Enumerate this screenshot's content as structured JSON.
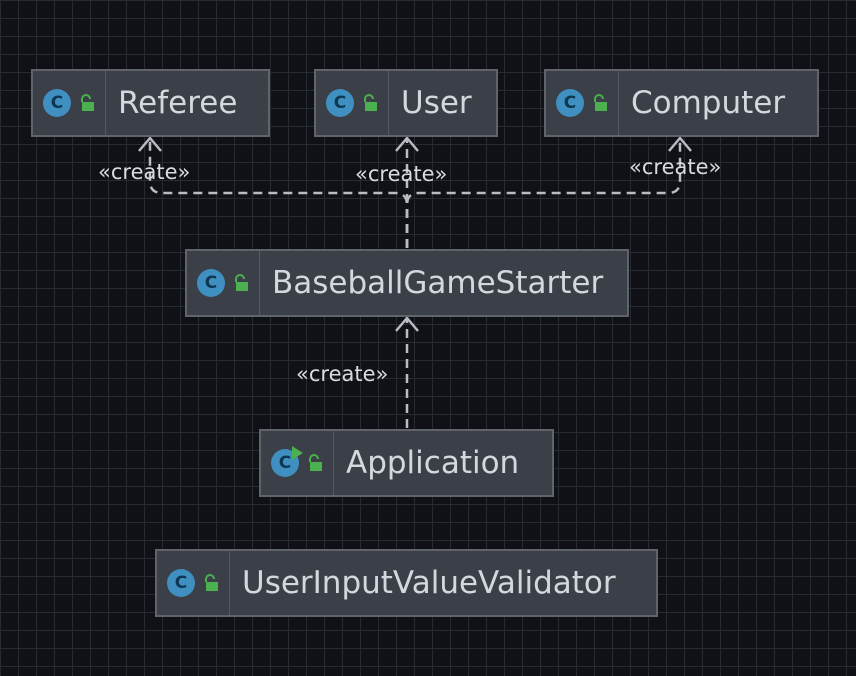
{
  "diagram": {
    "nodes": {
      "referee": {
        "name": "Referee",
        "icon": "class-icon",
        "visibility": "public-lock-icon"
      },
      "user": {
        "name": "User",
        "icon": "class-icon",
        "visibility": "public-lock-icon"
      },
      "computer": {
        "name": "Computer",
        "icon": "class-icon",
        "visibility": "public-lock-icon"
      },
      "baseball_game_starter": {
        "name": "BaseballGameStarter",
        "icon": "class-icon",
        "visibility": "public-lock-icon"
      },
      "application": {
        "name": "Application",
        "icon": "runnable-class-icon",
        "visibility": "public-lock-icon"
      },
      "user_input_value_validator": {
        "name": "UserInputValueValidator",
        "icon": "class-icon",
        "visibility": "public-lock-icon"
      }
    },
    "edges": [
      {
        "from": "BaseballGameStarter",
        "to": "Referee",
        "label": "«create»"
      },
      {
        "from": "BaseballGameStarter",
        "to": "User",
        "label": "«create»"
      },
      {
        "from": "BaseballGameStarter",
        "to": "Computer",
        "label": "«create»"
      },
      {
        "from": "Application",
        "to": "BaseballGameStarter",
        "label": "«create»"
      }
    ],
    "icon_letter": "C"
  },
  "colors": {
    "background": "#0f1116",
    "grid": "#262a31",
    "node_fill": "#3b3f47",
    "node_border": "#5f646b",
    "class_icon": "#3f8fc0",
    "lock_icon": "#4caf50",
    "text": "#d4d8de",
    "edge": "#b9bcc2"
  }
}
